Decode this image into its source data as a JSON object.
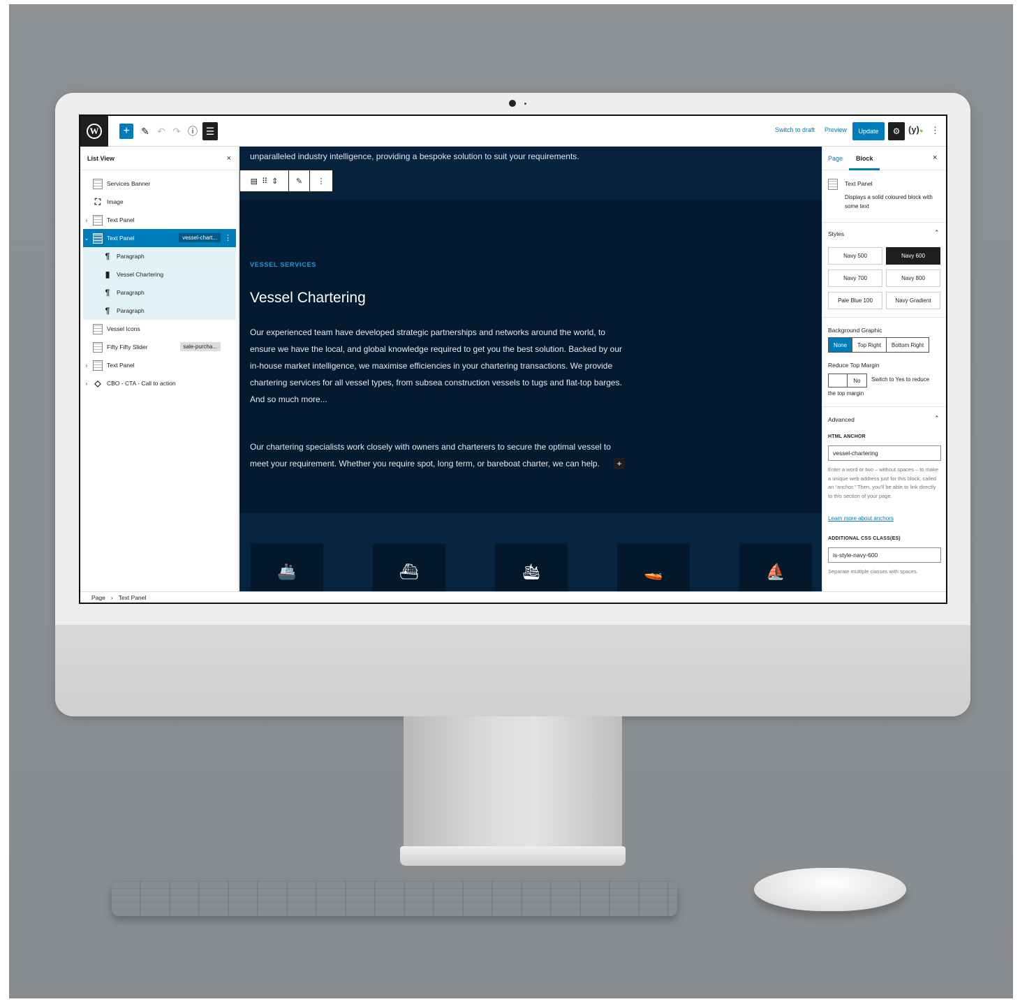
{
  "toolbar": {
    "add_label": "+",
    "switch_to_draft": "Switch to draft",
    "preview": "Preview",
    "update": "Update"
  },
  "list_view": {
    "title": "List View",
    "close": "×",
    "items": [
      {
        "label": "Services Banner",
        "icon": "block-icon"
      },
      {
        "label": "Image",
        "icon": "image-icon"
      },
      {
        "label": "Text Panel",
        "icon": "block-icon"
      },
      {
        "label": "Text Panel",
        "icon": "block-icon",
        "tag": "vessel-chart..."
      },
      {
        "label": "Paragraph",
        "icon": "paragraph-icon"
      },
      {
        "label": "Vessel Chartering",
        "icon": "bookmark-icon"
      },
      {
        "label": "Paragraph",
        "icon": "paragraph-icon"
      },
      {
        "label": "Paragraph",
        "icon": "paragraph-icon"
      },
      {
        "label": "Vessel Icons",
        "icon": "block-icon"
      },
      {
        "label": "Fifty Fifty Slider",
        "icon": "block-icon",
        "tag": "sale-purcha..."
      },
      {
        "label": "Text Panel",
        "icon": "block-icon"
      },
      {
        "label": "CBO - CTA - Call to action",
        "icon": "reusable-icon"
      }
    ]
  },
  "content": {
    "intro": "unparalleled industry intelligence, providing a bespoke solution to suit your requirements.",
    "label": "VESSEL SERVICES",
    "title": "Vessel Chartering",
    "para1": "Our experienced team have developed strategic partnerships and networks around the world, to ensure we have the local, and global knowledge required to get you the best solution. Backed by our in-house market intelligence, we maximise efficiencies in your chartering transactions. We provide chartering services for all vessel types, from subsea construction vessels to tugs and flat-top barges. And so much more...",
    "para2": "Our chartering specialists work closely with owners and charterers to secure the optimal vessel to meet your requirement. Whether you require spot, long term, or bareboat charter, we can help."
  },
  "sidebar": {
    "tab_page": "Page",
    "tab_block": "Block",
    "block_title": "Text Panel",
    "block_desc": "Displays a solid coloured block with some text",
    "styles_heading": "Styles",
    "styles": [
      "Navy 500",
      "Navy 600",
      "Navy 700",
      "Navy 800",
      "Pale Blue 100",
      "Navy Gradient"
    ],
    "active_style": "Navy 600",
    "bg_graphic_label": "Background Graphic",
    "bg_options": [
      "None",
      "Top Right",
      "Bottom Right"
    ],
    "bg_selected": "None",
    "reduce_margin_label": "Reduce Top Margin",
    "toggle_value": "No",
    "toggle_help_1": "Switch to Yes to reduce",
    "toggle_help_2": "the top margin",
    "advanced_heading": "Advanced",
    "html_anchor_label": "HTML ANCHOR",
    "html_anchor_value": "vessel-chartering",
    "anchor_help": "Enter a word or two – without spaces – to make a unique web address just for this block, called an “anchor.” Then, you’ll be able to link directly to this section of your page.",
    "anchor_link": "Learn more about anchors",
    "css_label": "ADDITIONAL CSS CLASS(ES)",
    "css_value": "is-style-navy-600",
    "css_help": "Separate multiple classes with spaces."
  },
  "breadcrumb": {
    "root": "Page",
    "sep": "›",
    "current": "Text Panel"
  },
  "colors": {
    "wp_blue": "#007cba",
    "navy": "#041a30",
    "accent_label": "#1e9be0"
  }
}
